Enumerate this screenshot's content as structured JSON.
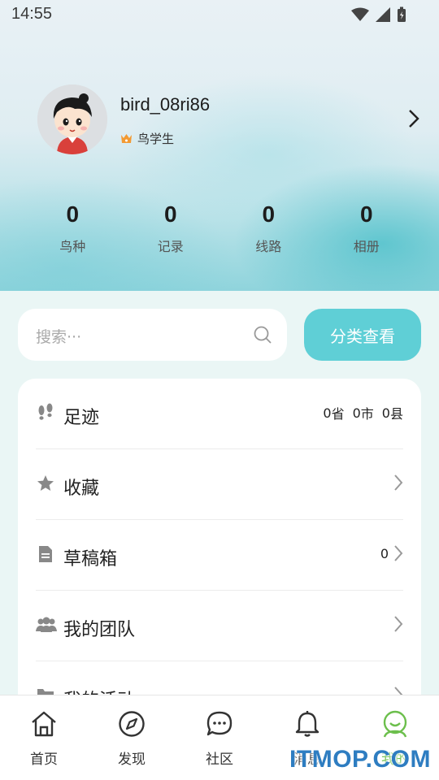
{
  "status_bar": {
    "time": "14:55"
  },
  "profile": {
    "username": "bird_08ri86",
    "level": "鸟学生"
  },
  "stats": [
    {
      "value": "0",
      "label": "鸟种"
    },
    {
      "value": "0",
      "label": "记录"
    },
    {
      "value": "0",
      "label": "线路"
    },
    {
      "value": "0",
      "label": "相册"
    }
  ],
  "search": {
    "placeholder": "搜索···"
  },
  "category_button": {
    "label": "分类查看"
  },
  "menu": {
    "footprint": {
      "label": "足迹",
      "province_value": "0",
      "province_unit": "省",
      "city_value": "0",
      "city_unit": "市",
      "county_value": "0",
      "county_unit": "县"
    },
    "favorites": {
      "label": "收藏"
    },
    "drafts": {
      "label": "草稿箱",
      "count": "0"
    },
    "team": {
      "label": "我的团队"
    },
    "activity": {
      "label": "我的活动"
    }
  },
  "tabbar": {
    "items": [
      {
        "label": "首页",
        "icon": "home-icon"
      },
      {
        "label": "发现",
        "icon": "compass-icon"
      },
      {
        "label": "社区",
        "icon": "chat-icon"
      },
      {
        "label": "消息",
        "icon": "bell-icon"
      },
      {
        "label": "我的",
        "icon": "user-icon",
        "active": true
      }
    ],
    "active_color": "#6cbf4c"
  },
  "colors": {
    "accent": "#5fcfd6",
    "active_tab": "#6cbf4c"
  },
  "watermark": "ITMOP.COM"
}
